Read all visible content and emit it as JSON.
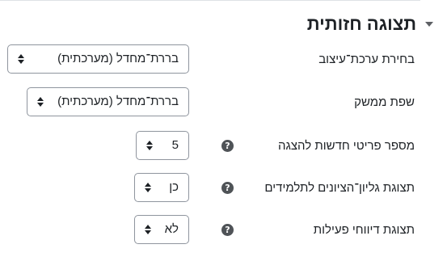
{
  "section": {
    "title": "תצוגה חזותית",
    "collapse_icon": "caret-down-icon"
  },
  "fields": [
    {
      "label": "בחירת ערכת־עיצוב",
      "value": "בררת־מחדל (מערכתית)",
      "has_help": false
    },
    {
      "label": "שפת ממשק",
      "value": "בררת־מחדל (מערכתית)",
      "has_help": false
    },
    {
      "label": "מספר פריטי חדשות להצגה",
      "value": "5",
      "has_help": true,
      "help_icon": "question-circle-icon",
      "help_glyph": "?"
    },
    {
      "label": "תצוגת גליון־הציונים לתלמידים",
      "value": "כן",
      "has_help": true,
      "help_icon": "question-circle-icon",
      "help_glyph": "?"
    },
    {
      "label": "תצוגת דיווחי פעילות",
      "value": "לא",
      "has_help": true,
      "help_icon": "question-circle-icon",
      "help_glyph": "?"
    }
  ]
}
